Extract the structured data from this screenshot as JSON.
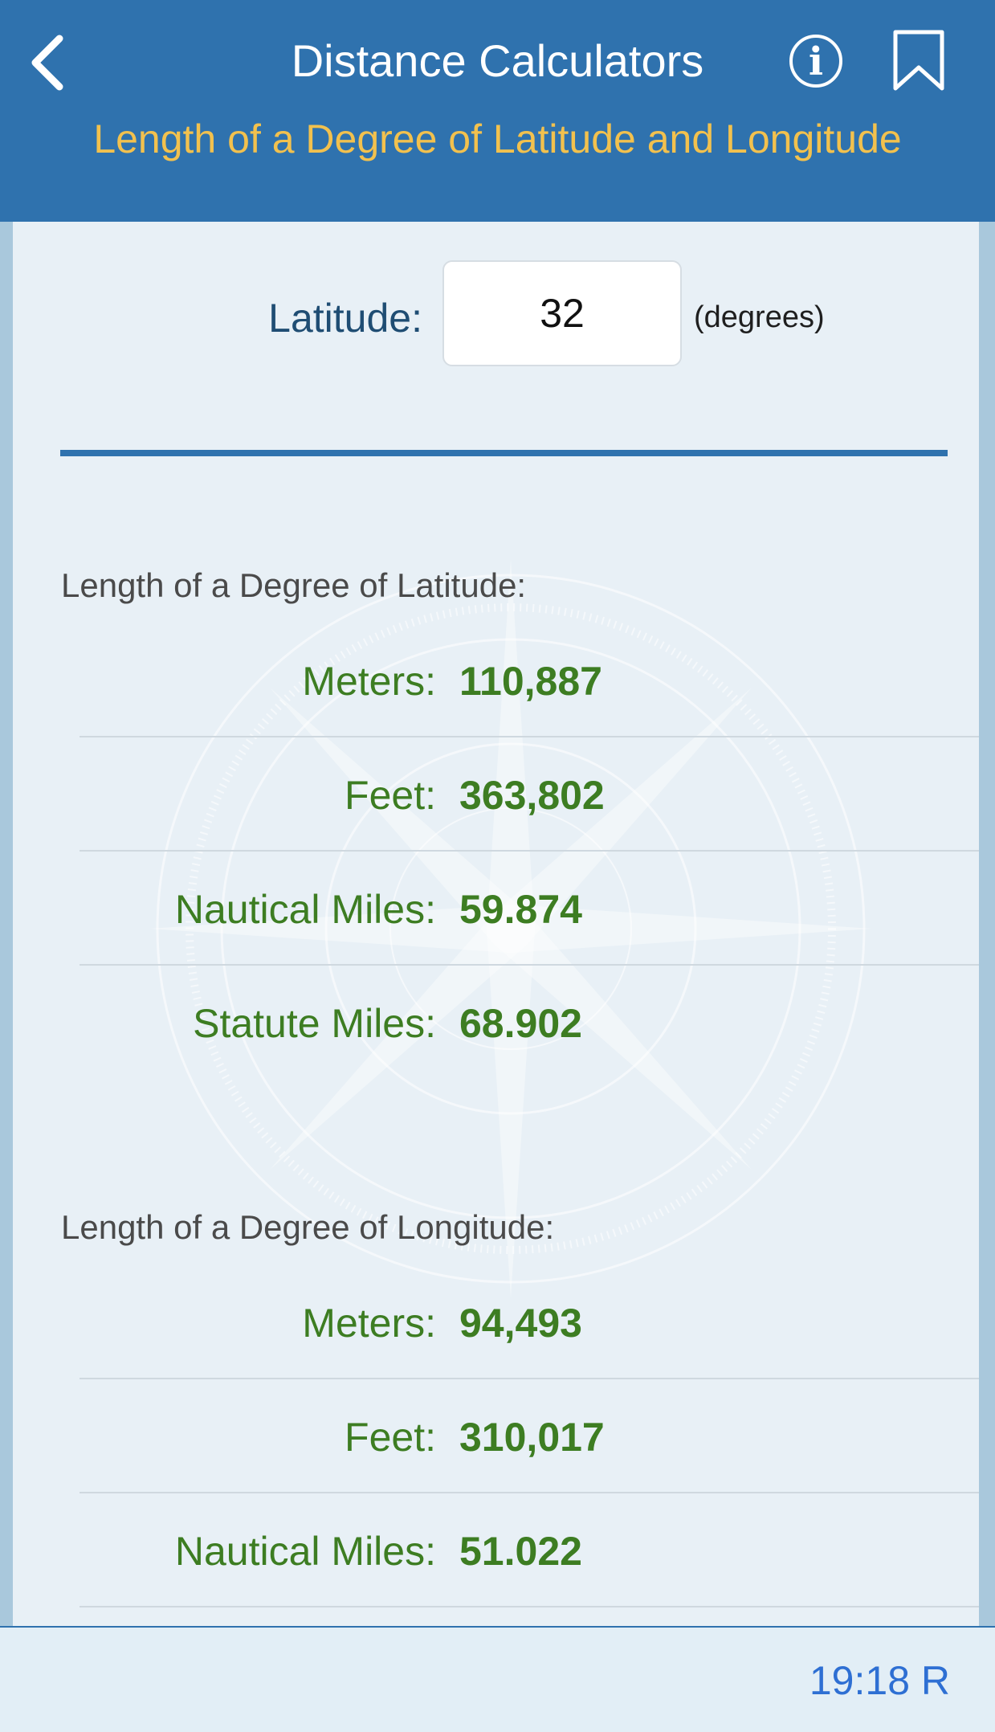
{
  "header": {
    "title": "Distance Calculators",
    "subtitle": "Length of a Degree of Latitude and Longitude",
    "back_icon": "chevron-left-icon",
    "info_icon": "info-icon",
    "bookmark_icon": "bookmark-icon"
  },
  "input": {
    "label": "Latitude:",
    "value": "32",
    "unit": "(degrees)"
  },
  "latitude_section": {
    "title": "Length of a Degree of Latitude:",
    "rows": [
      {
        "label": "Meters:",
        "value": "110,887"
      },
      {
        "label": "Feet:",
        "value": "363,802"
      },
      {
        "label": "Nautical Miles:",
        "value": "59.874"
      },
      {
        "label": "Statute Miles:",
        "value": "68.902"
      }
    ]
  },
  "longitude_section": {
    "title": "Length of a Degree of Longitude:",
    "rows": [
      {
        "label": "Meters:",
        "value": "94,493"
      },
      {
        "label": "Feet:",
        "value": "310,017"
      },
      {
        "label": "Nautical Miles:",
        "value": "51.022"
      }
    ]
  },
  "footer": {
    "time": "19:18 R"
  },
  "colors": {
    "header_bg": "#2f72ae",
    "subtitle": "#f2c14e",
    "value_green": "#3d7d22",
    "content_bg": "#e8f0f6"
  }
}
